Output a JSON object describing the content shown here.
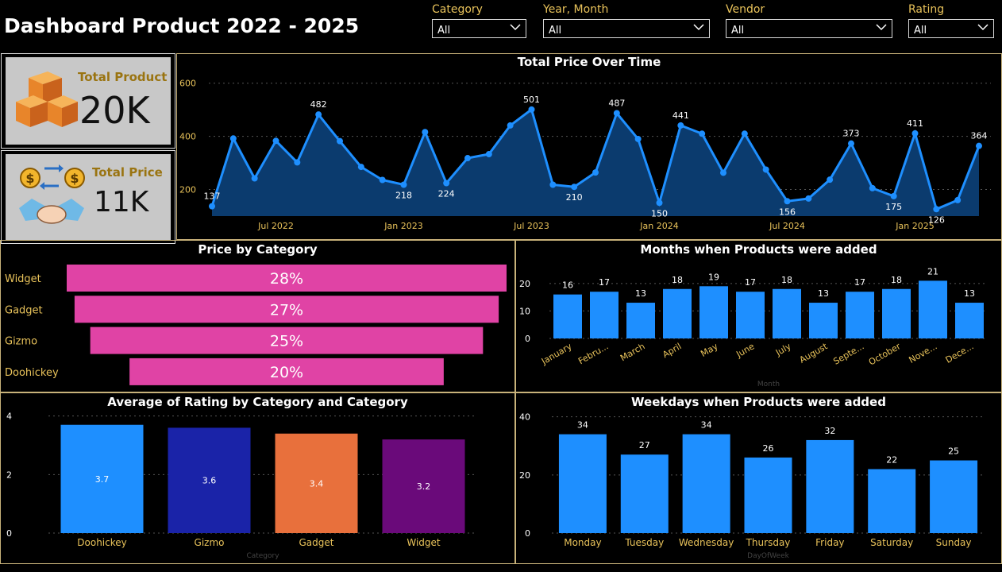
{
  "header": {
    "title": "Dashboard Product 2022 - 2025"
  },
  "slicers": [
    {
      "label": "Category",
      "value": "All"
    },
    {
      "label": "Year, Month",
      "value": "All"
    },
    {
      "label": "Vendor",
      "value": "All"
    },
    {
      "label": "Rating",
      "value": "All"
    }
  ],
  "kpis": {
    "total_product": {
      "label": "Total Product",
      "value": "20K"
    },
    "total_price": {
      "label": "Total Price",
      "value": "11K"
    }
  },
  "chart_data": [
    {
      "type": "area",
      "title": "Total Price Over Time",
      "y_ticks": [
        200,
        400,
        600
      ],
      "ylim": [
        100,
        620
      ],
      "x_tick_labels": [
        "Jul 2022",
        "Jan 2023",
        "Jul 2023",
        "Jan 2024",
        "Jul 2024",
        "Jan 2025"
      ],
      "x_tick_index": [
        3,
        9,
        15,
        21,
        27,
        33
      ],
      "values": [
        137,
        392,
        242,
        383,
        302,
        482,
        382,
        285,
        236,
        218,
        416,
        224,
        318,
        333,
        441,
        501,
        218,
        210,
        264,
        487,
        390,
        150,
        441,
        410,
        263,
        410,
        275,
        156,
        166,
        237,
        373,
        205,
        175,
        411,
        126,
        160,
        364
      ],
      "labeled_points": [
        {
          "i": 0,
          "text": "137"
        },
        {
          "i": 5,
          "text": "482"
        },
        {
          "i": 9,
          "text": "218"
        },
        {
          "i": 11,
          "text": "224"
        },
        {
          "i": 15,
          "text": "501"
        },
        {
          "i": 17,
          "text": "210"
        },
        {
          "i": 19,
          "text": "487"
        },
        {
          "i": 21,
          "text": "150"
        },
        {
          "i": 22,
          "text": "441"
        },
        {
          "i": 27,
          "text": "156"
        },
        {
          "i": 30,
          "text": "373"
        },
        {
          "i": 32,
          "text": "175"
        },
        {
          "i": 33,
          "text": "411"
        },
        {
          "i": 34,
          "text": "126"
        },
        {
          "i": 36,
          "text": "364"
        }
      ],
      "grid": true,
      "color": "#1e8fff"
    },
    {
      "type": "bar",
      "orientation": "horizontal",
      "title": "Price by Category",
      "categories": [
        "Widget",
        "Gadget",
        "Gizmo",
        "Doohickey"
      ],
      "values": [
        28,
        27,
        25,
        20
      ],
      "labels": [
        "28%",
        "27%",
        "25%",
        "20%"
      ],
      "color": "#e043a5"
    },
    {
      "type": "bar",
      "title": "Months when Products were added",
      "categories": [
        "January",
        "Febru...",
        "March",
        "April",
        "May",
        "June",
        "July",
        "August",
        "Septe...",
        "October",
        "Nove...",
        "Dece..."
      ],
      "values": [
        16,
        17,
        13,
        18,
        19,
        17,
        18,
        13,
        17,
        18,
        21,
        13
      ],
      "y_ticks": [
        0,
        10,
        20
      ],
      "ylim": [
        0,
        24
      ],
      "xlabel": "Month",
      "color": "#1e8fff"
    },
    {
      "type": "bar",
      "title": "Average of Rating by Category and Category",
      "categories": [
        "Doohickey",
        "Gizmo",
        "Gadget",
        "Widget"
      ],
      "values": [
        3.7,
        3.6,
        3.4,
        3.2
      ],
      "labels": [
        "3.7",
        "3.6",
        "3.4",
        "3.2"
      ],
      "colors": [
        "#1e8fff",
        "#1a23a8",
        "#e8703c",
        "#6a0a7a"
      ],
      "y_ticks": [
        0,
        2,
        4
      ],
      "ylim": [
        0,
        4.1
      ],
      "xlabel": "Category"
    },
    {
      "type": "bar",
      "title": "Weekdays when Products were added",
      "categories": [
        "Monday",
        "Tuesday",
        "Wednesday",
        "Thursday",
        "Friday",
        "Saturday",
        "Sunday"
      ],
      "values": [
        34,
        27,
        34,
        26,
        32,
        22,
        25
      ],
      "y_ticks": [
        0,
        20,
        40
      ],
      "ylim": [
        0,
        41
      ],
      "xlabel": "DayOfWeek",
      "color": "#1e8fff"
    }
  ]
}
